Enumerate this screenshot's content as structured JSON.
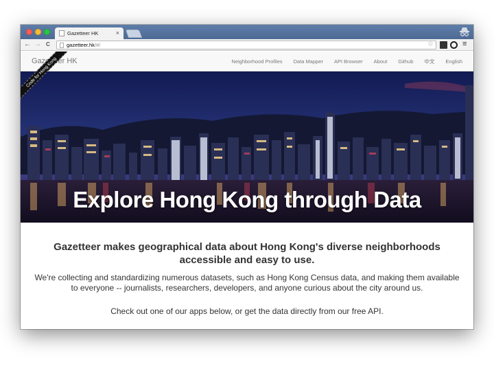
{
  "browser": {
    "tab_title": "Gazetteer HK",
    "tab_close": "×",
    "url_host": "gazetteer.hk",
    "url_path": "/#/",
    "back": "←",
    "forward": "→",
    "reload": "C"
  },
  "site": {
    "brand": "Gazetteer HK",
    "nav": [
      {
        "label": "Neighborhood Profiles"
      },
      {
        "label": "Data Mapper"
      },
      {
        "label": "API Browser"
      },
      {
        "label": "About"
      },
      {
        "label": "Github"
      },
      {
        "label": "中文"
      },
      {
        "label": "English"
      }
    ],
    "ribbon": "Code for Hong Kong"
  },
  "hero": {
    "title": "Explore Hong Kong through Data"
  },
  "content": {
    "lead": "Gazetteer makes geographical data about Hong Kong's diverse neighborhoods accessible and easy to use.",
    "para": "We're collecting and standardizing numerous datasets, such as Hong Kong Census data, and making them available to everyone -- journalists, researchers, developers, and anyone curious about the city around us.",
    "para2": "Check out one of our apps below, or get the data directly from our free API."
  },
  "colors": {
    "titlebar": "#5e7da8",
    "navbar": "#f8f8f8",
    "sky": "#1a2560",
    "ribbon": "#111111"
  }
}
